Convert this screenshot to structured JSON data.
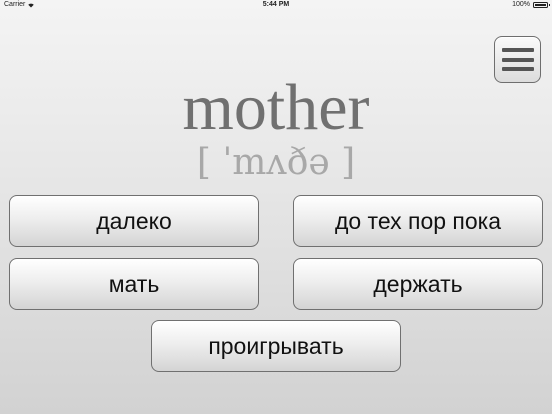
{
  "status_bar": {
    "carrier": "Carrier",
    "time": "5:44 PM",
    "battery_percent": "100%",
    "battery_level": 1.0
  },
  "menu": {
    "icon": "hamburger-menu-icon"
  },
  "card": {
    "word": "mother",
    "transcription": "[ ˈmʌðə ]"
  },
  "answers": [
    {
      "label": "далеко"
    },
    {
      "label": "до тех пор пока"
    },
    {
      "label": "мать"
    },
    {
      "label": "держать"
    },
    {
      "label": "проигрывать"
    }
  ],
  "colors": {
    "word": "#707070",
    "transcription": "#a8a8a8",
    "button_border": "#707070"
  }
}
